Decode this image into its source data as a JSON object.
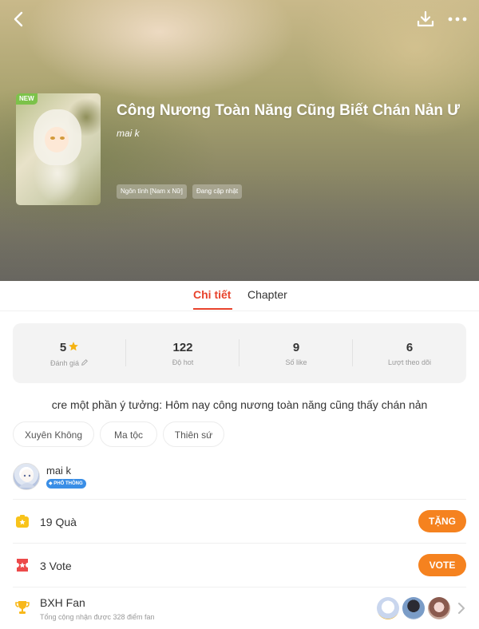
{
  "header": {
    "new_badge": "NEW",
    "title": "Công Nương Toàn Năng Cũng Biết Chán Nản Ư",
    "author": "mai k",
    "tags": [
      "Ngôn tình [Nam x Nữ]",
      "Đang cập nhật"
    ]
  },
  "tabs": [
    {
      "label": "Chi tiết",
      "active": true
    },
    {
      "label": "Chapter",
      "active": false
    }
  ],
  "stats": [
    {
      "value": "5",
      "label": "Đánh giá",
      "icon": "star-icon"
    },
    {
      "value": "122",
      "label": "Độ hot"
    },
    {
      "value": "9",
      "label": "Số like"
    },
    {
      "value": "6",
      "label": "Lượt theo dõi"
    }
  ],
  "description": "cre một phần ý tưởng: Hôm nay công nương toàn năng cũng thấy chán nản",
  "genres": [
    "Xuyên Không",
    "Ma tộc",
    "Thiên sứ"
  ],
  "author_card": {
    "name": "mai k",
    "badge": "PHỔ THÔNG"
  },
  "gifts": {
    "label": "19 Quà",
    "button": "TẶNG"
  },
  "votes": {
    "label": "3 Vote",
    "button": "VOTE"
  },
  "fan_ranking": {
    "title": "BXH Fan",
    "subtitle": "Tổng cộng nhận được 328 điểm fan"
  },
  "colors": {
    "accent_red": "#e8432c",
    "button_orange": "#f5821f",
    "badge_blue": "#3a8ee6",
    "new_badge_green": "#7cc24a"
  }
}
